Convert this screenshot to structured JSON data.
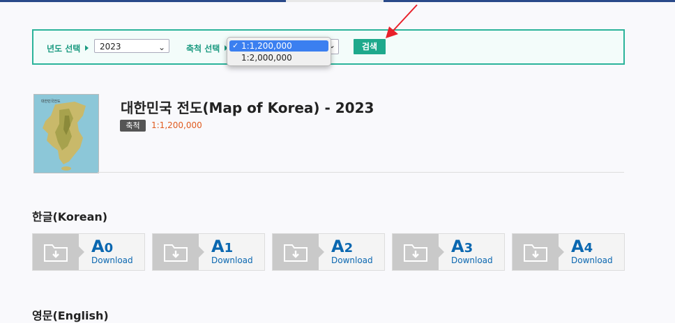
{
  "search": {
    "year_label": "년도 선택",
    "year_value": "2023",
    "scale_label": "축척 선택",
    "scale_options": [
      "1:1,200,000",
      "1:2,000,000"
    ],
    "search_button": "검색"
  },
  "map": {
    "thumbnail_title": "대한민국전도",
    "title": "대한민국 전도(Map of Korea) - 2023",
    "scale_badge": "축척",
    "scale_value": "1:1,200,000"
  },
  "sections": [
    {
      "title": "한글(Korean)",
      "downloads": [
        {
          "letter": "A",
          "num": "0",
          "label": "Download"
        },
        {
          "letter": "A",
          "num": "1",
          "label": "Download"
        },
        {
          "letter": "A",
          "num": "2",
          "label": "Download"
        },
        {
          "letter": "A",
          "num": "3",
          "label": "Download"
        },
        {
          "letter": "A",
          "num": "4",
          "label": "Download"
        }
      ]
    },
    {
      "title": "영문(English)"
    }
  ],
  "colors": {
    "accent": "#1ea98c",
    "link": "#0a67b0",
    "highlight": "#e05a1e",
    "annotation_arrow": "#e8202a"
  }
}
